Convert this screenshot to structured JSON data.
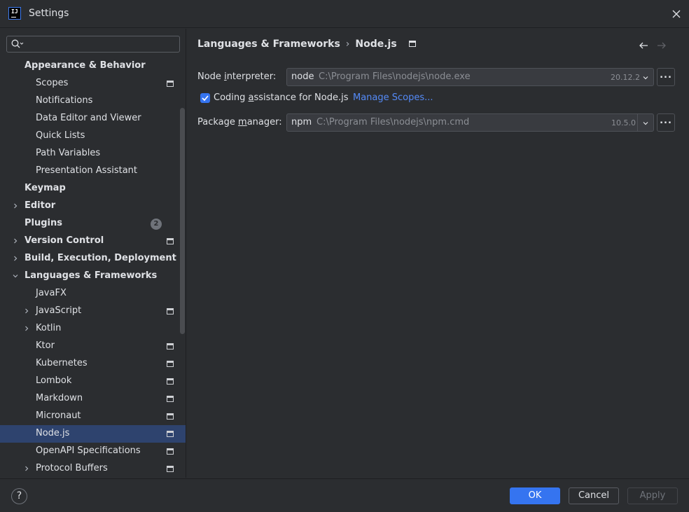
{
  "window": {
    "title": "Settings",
    "icon_text": "IJ"
  },
  "sidebar": {
    "search": {
      "value": "",
      "placeholder": ""
    },
    "items": [
      {
        "label": "Appearance & Behavior",
        "level": 0,
        "bold": true,
        "expanded": true,
        "project": false
      },
      {
        "label": "Scopes",
        "level": 1,
        "project": true
      },
      {
        "label": "Notifications",
        "level": 1
      },
      {
        "label": "Data Editor and Viewer",
        "level": 1
      },
      {
        "label": "Quick Lists",
        "level": 1
      },
      {
        "label": "Path Variables",
        "level": 1
      },
      {
        "label": "Presentation Assistant",
        "level": 1
      },
      {
        "label": "Keymap",
        "level": 0,
        "bold": true
      },
      {
        "label": "Editor",
        "level": 0,
        "bold": true,
        "collapsed": true
      },
      {
        "label": "Plugins",
        "level": 0,
        "bold": true,
        "badge": "2"
      },
      {
        "label": "Version Control",
        "level": 0,
        "bold": true,
        "collapsed": true,
        "project": true
      },
      {
        "label": "Build, Execution, Deployment",
        "level": 0,
        "bold": true,
        "collapsed": true
      },
      {
        "label": "Languages & Frameworks",
        "level": 0,
        "bold": true,
        "expanded": true
      },
      {
        "label": "JavaFX",
        "level": 1
      },
      {
        "label": "JavaScript",
        "level": 1,
        "collapsed": true,
        "project": true
      },
      {
        "label": "Kotlin",
        "level": 1,
        "collapsed": true
      },
      {
        "label": "Ktor",
        "level": 1,
        "project": true
      },
      {
        "label": "Kubernetes",
        "level": 1,
        "project": true
      },
      {
        "label": "Lombok",
        "level": 1,
        "project": true
      },
      {
        "label": "Markdown",
        "level": 1,
        "project": true
      },
      {
        "label": "Micronaut",
        "level": 1,
        "project": true
      },
      {
        "label": "Node.js",
        "level": 1,
        "project": true,
        "selected": true
      },
      {
        "label": "OpenAPI Specifications",
        "level": 1,
        "project": true
      },
      {
        "label": "Protocol Buffers",
        "level": 1,
        "collapsed": true,
        "project": true
      }
    ]
  },
  "main": {
    "breadcrumb": {
      "parent": "Languages & Frameworks",
      "separator": "›",
      "current": "Node.js"
    },
    "interpreter": {
      "label_pre": "Node ",
      "label_mnemonic": "i",
      "label_post": "nterpreter:",
      "name": "node",
      "path": "C:\\Program Files\\nodejs\\node.exe",
      "version": "20.12.2",
      "browse": "..."
    },
    "coding_assistance": {
      "checked": true,
      "label_pre": "Coding ",
      "label_mnemonic": "a",
      "label_post": "ssistance for Node.js",
      "link": "Manage Scopes..."
    },
    "package_manager": {
      "label_pre": "Package ",
      "label_mnemonic": "m",
      "label_post": "anager:",
      "name": "npm",
      "path": "C:\\Program Files\\nodejs\\npm.cmd",
      "version": "10.5.0",
      "browse": "..."
    }
  },
  "footer": {
    "help": "?",
    "ok": "OK",
    "cancel": "Cancel",
    "apply": "Apply"
  },
  "colors": {
    "background": "#2b2d30",
    "selection": "#2e436e",
    "accent": "#3574f0",
    "link": "#548af7",
    "text": "#dfe1e5",
    "muted": "#8b8e94"
  }
}
